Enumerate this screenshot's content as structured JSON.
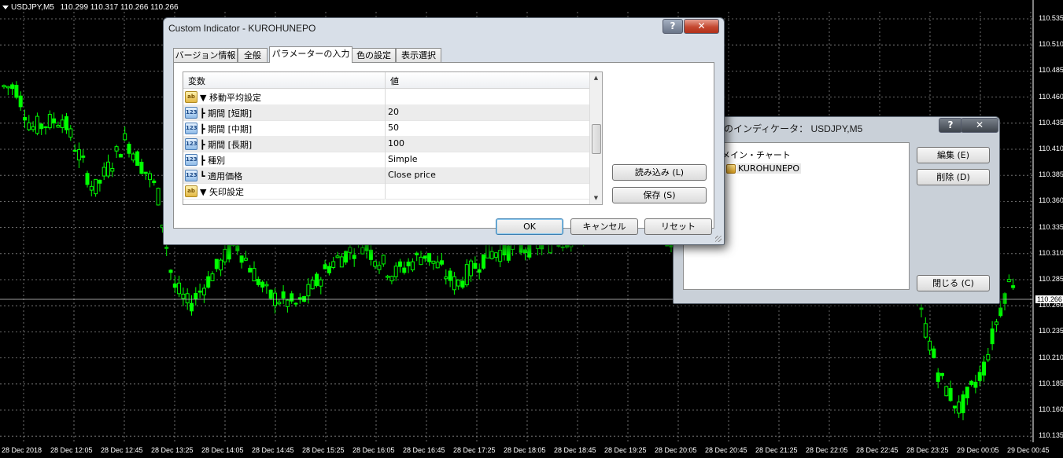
{
  "chart": {
    "symbol": "USDJPY,M5",
    "ohlc": "110.299 110.317 110.266 110.266",
    "current_price": "110.266",
    "price_labels": [
      "110.535",
      "110.510",
      "110.485",
      "110.460",
      "110.435",
      "110.410",
      "110.385",
      "110.360",
      "110.335",
      "110.310",
      "110.285",
      "110.260",
      "110.235",
      "110.210",
      "110.185",
      "110.160",
      "110.135"
    ],
    "time_labels": [
      "28 Dec 2018",
      "28 Dec 12:05",
      "28 Dec 12:45",
      "28 Dec 13:25",
      "28 Dec 14:05",
      "28 Dec 14:45",
      "28 Dec 15:25",
      "28 Dec 16:05",
      "28 Dec 16:45",
      "28 Dec 17:25",
      "28 Dec 18:05",
      "28 Dec 18:45",
      "28 Dec 19:25",
      "28 Dec 20:05",
      "28 Dec 20:45",
      "28 Dec 21:25",
      "28 Dec 22:05",
      "28 Dec 22:45",
      "28 Dec 23:25",
      "29 Dec 00:05",
      "29 Dec 00:45"
    ],
    "colors": {
      "background": "#000000",
      "grid": "#8a8a8a",
      "candle": "#00ff00",
      "text": "#ffffff"
    }
  },
  "custom_indicator": {
    "title": "Custom Indicator - KUROHUNEPO",
    "help": "?",
    "close": "✕",
    "tabs": [
      "バージョン情報",
      "全般",
      "パラメーターの入力",
      "色の設定",
      "表示選択"
    ],
    "active_tab": "パラメーターの入力",
    "grid_headers": {
      "variable": "変数",
      "value": "値"
    },
    "rows": [
      {
        "icon": "ab",
        "name": "▼ 移動平均設定",
        "value": ""
      },
      {
        "icon": "123",
        "name": "┣ 期間 [短期]",
        "value": "20"
      },
      {
        "icon": "123",
        "name": "┣ 期間 [中期]",
        "value": "50"
      },
      {
        "icon": "123",
        "name": "┣ 期間 [長期]",
        "value": "100"
      },
      {
        "icon": "123",
        "name": "┣ 種別",
        "value": "Simple"
      },
      {
        "icon": "123",
        "name": "┗ 適用価格",
        "value": "Close price"
      },
      {
        "icon": "ab",
        "name": "▼ 矢印設定",
        "value": ""
      }
    ],
    "load_button": "読み込み (L)",
    "save_button": "保存 (S)",
    "ok_button": "OK",
    "cancel_button": "キャンセル",
    "reset_button": "リセット"
  },
  "indicators_window": {
    "title": "のインディケータ： USDJPY,M5",
    "help": "?",
    "close": "✕",
    "list_root": "メイン・チャート",
    "list_item": "KUROHUNEPO",
    "edit_button": "編集 (E)",
    "delete_button": "削除 (D)",
    "close_button": "閉じる (C)"
  }
}
